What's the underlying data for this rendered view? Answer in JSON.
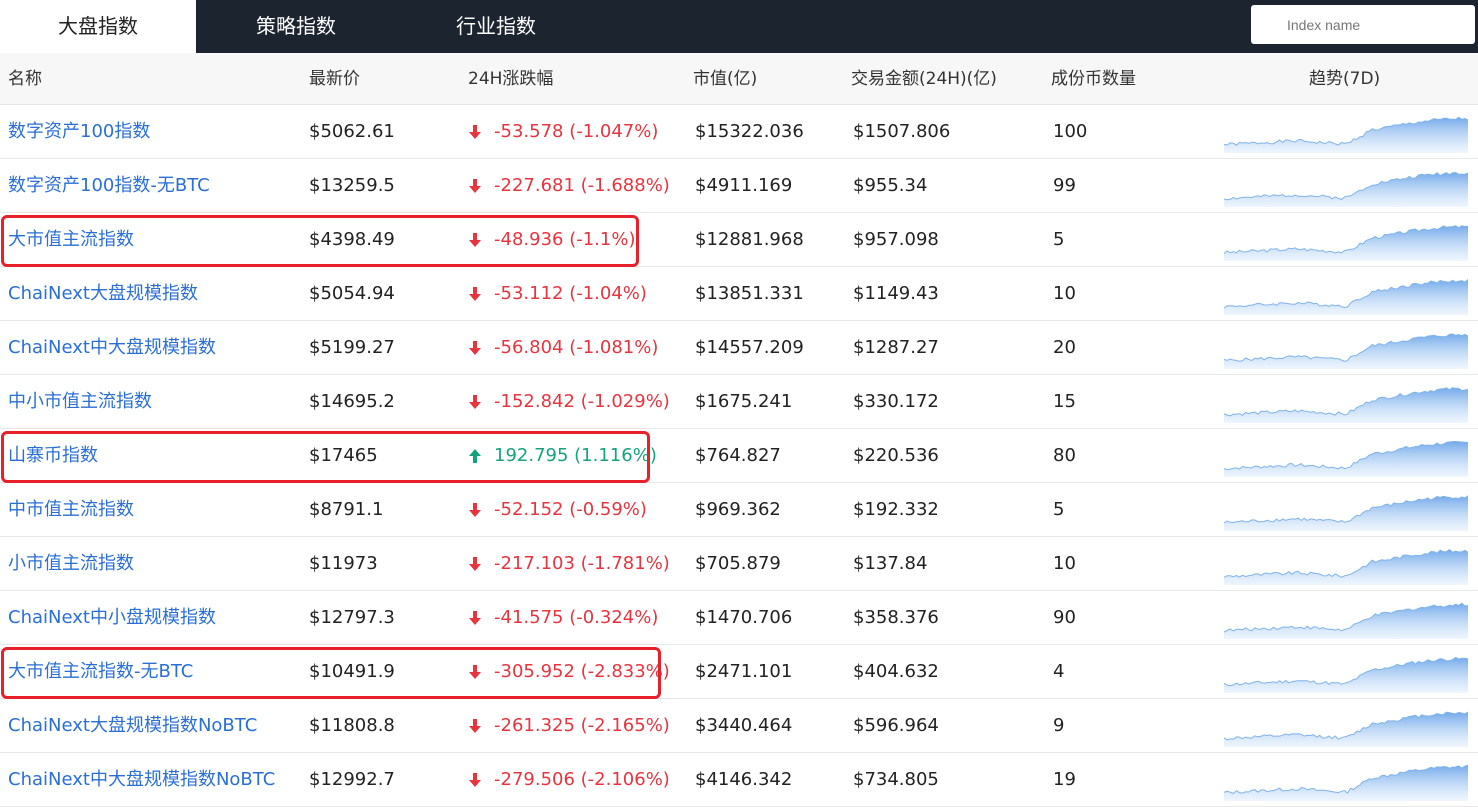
{
  "tabs": [
    {
      "label": "大盘指数",
      "active": true
    },
    {
      "label": "策略指数",
      "active": false
    },
    {
      "label": "行业指数",
      "active": false
    }
  ],
  "search": {
    "placeholder": "Index name"
  },
  "headers": {
    "name": "名称",
    "price": "最新价",
    "change": "24H涨跌幅",
    "mcap": "市值(亿)",
    "volume": "交易金额(24H)(亿)",
    "count": "成份币数量",
    "trend": "趋势(7D)"
  },
  "colors": {
    "down": "#e8343f",
    "up": "#14a37f",
    "link": "#2a6fd6",
    "highlight": "#e8202a",
    "sparkline": "#7fb3ea"
  },
  "rows": [
    {
      "name": "数字资产100指数",
      "price": "$5062.61",
      "direction": "down",
      "change": "-53.578 (-1.047%)",
      "mcap": "$15322.036",
      "volume": "$1507.806",
      "count": "100",
      "highlighted": false
    },
    {
      "name": "数字资产100指数-无BTC",
      "price": "$13259.5",
      "direction": "down",
      "change": "-227.681 (-1.688%)",
      "mcap": "$4911.169",
      "volume": "$955.34",
      "count": "99",
      "highlighted": false
    },
    {
      "name": "大市值主流指数",
      "price": "$4398.49",
      "direction": "down",
      "change": "-48.936 (-1.1%)",
      "mcap": "$12881.968",
      "volume": "$957.098",
      "count": "5",
      "highlighted": true
    },
    {
      "name": "ChaiNext大盘规模指数",
      "price": "$5054.94",
      "direction": "down",
      "change": "-53.112 (-1.04%)",
      "mcap": "$13851.331",
      "volume": "$1149.43",
      "count": "10",
      "highlighted": false
    },
    {
      "name": "ChaiNext中大盘规模指数",
      "price": "$5199.27",
      "direction": "down",
      "change": "-56.804 (-1.081%)",
      "mcap": "$14557.209",
      "volume": "$1287.27",
      "count": "20",
      "highlighted": false
    },
    {
      "name": "中小市值主流指数",
      "price": "$14695.2",
      "direction": "down",
      "change": "-152.842 (-1.029%)",
      "mcap": "$1675.241",
      "volume": "$330.172",
      "count": "15",
      "highlighted": false
    },
    {
      "name": "山寨币指数",
      "price": "$17465",
      "direction": "up",
      "change": "192.795 (1.116%)",
      "mcap": "$764.827",
      "volume": "$220.536",
      "count": "80",
      "highlighted": true
    },
    {
      "name": "中市值主流指数",
      "price": "$8791.1",
      "direction": "down",
      "change": "-52.152 (-0.59%)",
      "mcap": "$969.362",
      "volume": "$192.332",
      "count": "5",
      "highlighted": false
    },
    {
      "name": "小市值主流指数",
      "price": "$11973",
      "direction": "down",
      "change": "-217.103 (-1.781%)",
      "mcap": "$705.879",
      "volume": "$137.84",
      "count": "10",
      "highlighted": false
    },
    {
      "name": "ChaiNext中小盘规模指数",
      "price": "$12797.3",
      "direction": "down",
      "change": "-41.575 (-0.324%)",
      "mcap": "$1470.706",
      "volume": "$358.376",
      "count": "90",
      "highlighted": false
    },
    {
      "name": "大市值主流指数-无BTC",
      "price": "$10491.9",
      "direction": "down",
      "change": "-305.952 (-2.833%)",
      "mcap": "$2471.101",
      "volume": "$404.632",
      "count": "4",
      "highlighted": true
    },
    {
      "name": "ChaiNext大盘规模指数NoBTC",
      "price": "$11808.8",
      "direction": "down",
      "change": "-261.325 (-2.165%)",
      "mcap": "$3440.464",
      "volume": "$596.964",
      "count": "9",
      "highlighted": false
    },
    {
      "name": "ChaiNext中大盘规模指数NoBTC",
      "price": "$12992.7",
      "direction": "down",
      "change": "-279.506 (-2.106%)",
      "mcap": "$4146.342",
      "volume": "$734.805",
      "count": "19",
      "highlighted": false
    }
  ]
}
